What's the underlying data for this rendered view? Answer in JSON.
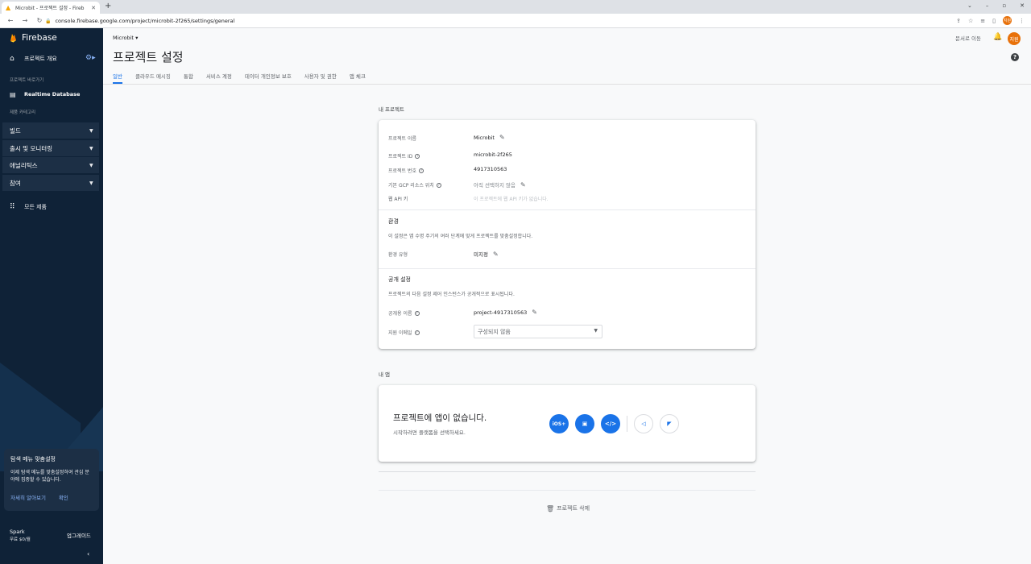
{
  "browser": {
    "tab_title": "Microbit - 프로젝트 설정 - Fireb",
    "url": "console.firebase.google.com/project/microbit-2f265/settings/general",
    "avatar_initials": "지원"
  },
  "sidebar": {
    "brand": "Firebase",
    "overview": "프로젝트 개요",
    "shortcuts_label": "프로젝트 바로가기",
    "rtdb": "Realtime Database",
    "product_category_label": "제품 카테고리",
    "categories": [
      "빌드",
      "출시 및 모니터링",
      "애널리틱스",
      "참여"
    ],
    "all_products": "모든 제품",
    "tip": {
      "title": "탐색 메뉴 맞춤설정",
      "body": "이제 탐색 메뉴를 맞춤설정하여 관심 분야에 집중할 수 있습니다.",
      "learn_more": "자세히 알아보기",
      "confirm": "확인"
    },
    "plan": {
      "name": "Spark",
      "price": "무료 $0/월",
      "upgrade": "업그레이드"
    }
  },
  "header": {
    "project": "Microbit",
    "docs": "문서로 이동",
    "avatar": "지원",
    "title": "프로젝트 설정",
    "tabs": [
      "일반",
      "클라우드 메시징",
      "통합",
      "서비스 계정",
      "데이터 개인정보 보호",
      "사용자 및 권한",
      "앱 체크"
    ]
  },
  "my_project": {
    "section_label": "내 프로젝트",
    "rows": {
      "name_label": "프로젝트 이름",
      "name_value": "Microbit",
      "id_label": "프로젝트 ID",
      "id_value": "microbit-2f265",
      "number_label": "프로젝트 번호",
      "number_value": "4917310563",
      "gcp_label": "기본 GCP 리소스 위치",
      "gcp_value": "아직 선택하지 않음",
      "api_label": "웹 API 키",
      "api_value": "이 프로젝트에 웹 API 키가 없습니다."
    },
    "environment": {
      "title": "환경",
      "desc": "이 설정은 앱 수명 주기의 여러 단계에 맞게 프로젝트를 맞춤설정합니다.",
      "type_label": "환경 유형",
      "type_value": "미지정"
    },
    "public": {
      "title": "공개 설정",
      "desc": "프로젝트의 다음 설정 제어 인스턴스가 공개적으로 표시됩니다.",
      "public_name_label": "공개용 이름",
      "public_name_value": "project-4917310563",
      "support_email_label": "지원 이메일",
      "support_email_value": "구성되지 않음"
    }
  },
  "my_apps": {
    "section_label": "내 앱",
    "title": "프로젝트에 앱이 없습니다.",
    "desc": "시작하려면 플랫폼을 선택하세요.",
    "platforms": {
      "ios": "iOS+"
    }
  },
  "delete_project": "프로젝트 삭제"
}
